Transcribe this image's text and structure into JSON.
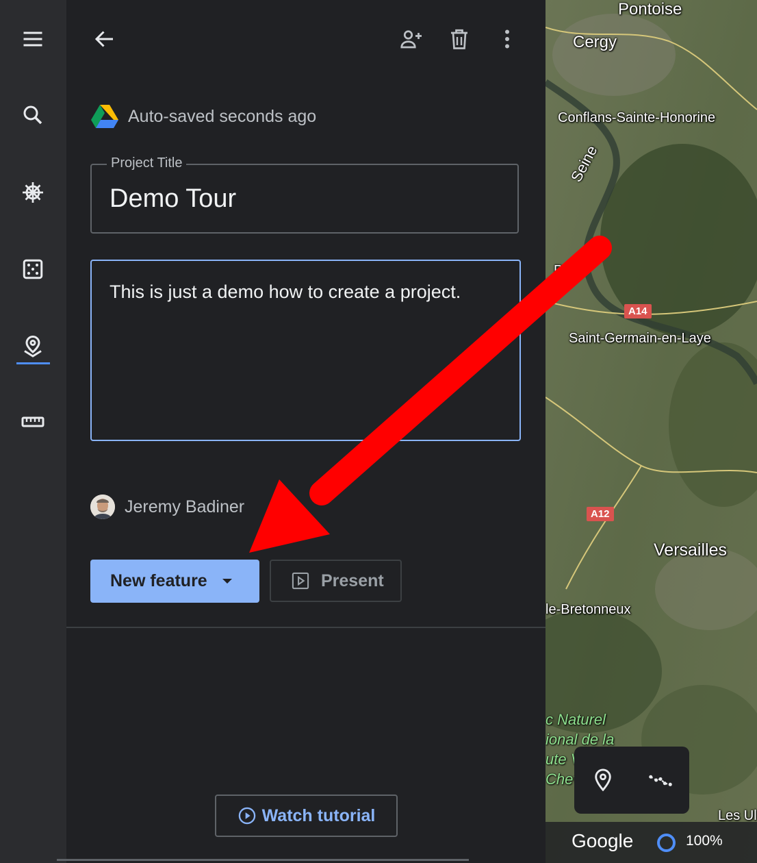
{
  "rail": {
    "items": [
      {
        "icon": "menu-icon"
      },
      {
        "icon": "search-icon"
      },
      {
        "icon": "voyager-wheel-icon"
      },
      {
        "icon": "feeling-lucky-dice-icon"
      },
      {
        "icon": "projects-pin-icon",
        "active": true
      },
      {
        "icon": "measure-ruler-icon"
      }
    ]
  },
  "header": {
    "back_icon": "arrow-back-icon",
    "actions": [
      "share-person-add-icon",
      "delete-trash-icon",
      "more-vert-icon"
    ]
  },
  "autosave": {
    "text": "Auto-saved seconds ago",
    "icon": "google-drive-icon"
  },
  "project": {
    "title_label": "Project Title",
    "title_value": "Demo Tour",
    "description": "This is just a demo how to create a project."
  },
  "author": {
    "name": "Jeremy Badiner"
  },
  "buttons": {
    "new_feature": "New feature",
    "present": "Present",
    "watch_tutorial": "Watch tutorial"
  },
  "map": {
    "labels": {
      "pontoise": "Pontoise",
      "cergy": "Cergy",
      "conflans": "Conflans-Sainte-Honorine",
      "seine": "Seine",
      "poissy_partial": "P",
      "saint_germain": "Saint-Germain-en-Laye",
      "a14": "A14",
      "a12": "A12",
      "versailles": "Versailles",
      "bretonneux": "le-Bretonneux",
      "park_line1": "c Naturel",
      "park_line2": "ional de la",
      "park_line3": "ute V",
      "park_line4": "Chev",
      "les_ul": "Les Ul"
    },
    "tools": [
      "add-placemark-pin-icon",
      "draw-path-icon"
    ],
    "footer": {
      "brand": "Google",
      "zoom": "100%"
    }
  },
  "colors": {
    "accent": "#8ab4f8",
    "panel_bg": "#202124",
    "rail_bg": "#2b2c2f",
    "arrow": "#ff0000"
  }
}
